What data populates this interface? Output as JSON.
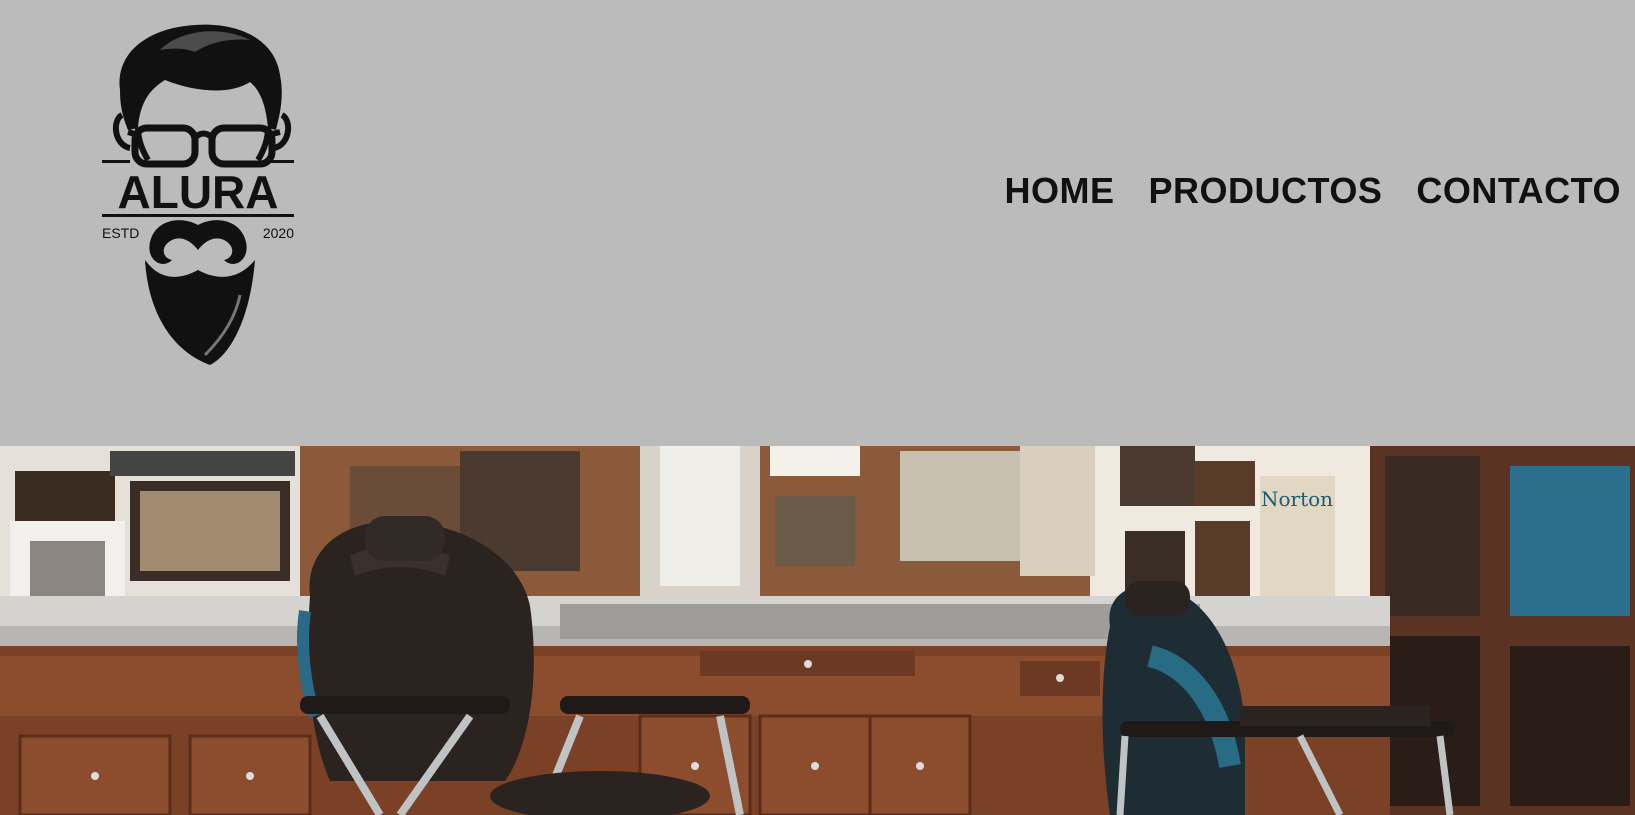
{
  "brand": {
    "name": "ALURA",
    "estd_label": "ESTD",
    "year": "2020"
  },
  "nav": {
    "items": [
      {
        "label": "HOME"
      },
      {
        "label": "PRODUCTOS"
      },
      {
        "label": "CONTACTO"
      }
    ]
  },
  "banner": {
    "poster_text": "Norton"
  },
  "colors": {
    "header_bg": "#bbbbbb",
    "nav_text": "#111111"
  }
}
